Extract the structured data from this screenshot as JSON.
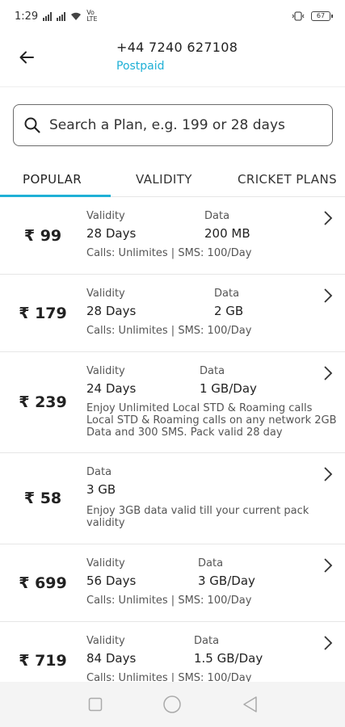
{
  "status_bar": {
    "time": "1:29",
    "network": "Vo LTE",
    "battery": "67"
  },
  "header": {
    "phone": "+44 7240 627108",
    "plan_type": "Postpaid"
  },
  "search": {
    "placeholder": "Search a Plan, e.g. 199 or 28 days"
  },
  "tabs": [
    {
      "label": "POPULAR",
      "active": true
    },
    {
      "label": "VALIDITY",
      "active": false
    },
    {
      "label": "CRICKET PLANS",
      "active": false
    }
  ],
  "plans": [
    {
      "price": "₹ 99",
      "validity_label": "Validity",
      "validity": "28 Days",
      "data_label": "Data",
      "data": "200 MB",
      "desc": "Calls: Unlimites | SMS: 100/Day"
    },
    {
      "price": "₹ 179",
      "validity_label": "Validity",
      "validity": "28 Days",
      "data_label": "Data",
      "data": "2 GB",
      "desc": "Calls: Unlimites | SMS: 100/Day"
    },
    {
      "price": "₹ 239",
      "validity_label": "Validity",
      "validity": "24 Days",
      "data_label": "Data",
      "data": "1 GB/Day",
      "desc": "Enjoy Unlimited Local STD & Roaming calls Local STD & Roaming calls on any network 2GB Data and 300 SMS. Pack valid 28 day"
    },
    {
      "price": "₹ 58",
      "data_label": "Data",
      "data": "3 GB",
      "desc": "Enjoy 3GB data valid till your current pack validity"
    },
    {
      "price": "₹ 699",
      "validity_label": "Validity",
      "validity": "56 Days",
      "data_label": "Data",
      "data": "3 GB/Day",
      "desc": "Calls: Unlimites | SMS: 100/Day"
    },
    {
      "price": "₹ 719",
      "validity_label": "Validity",
      "validity": "84 Days",
      "data_label": "Data",
      "data": "1.5 GB/Day",
      "desc": "Calls: Unlimites | SMS: 100/Day"
    }
  ],
  "colors": {
    "accent": "#1fb0d6",
    "nav_bg": "#f4f4f4"
  }
}
